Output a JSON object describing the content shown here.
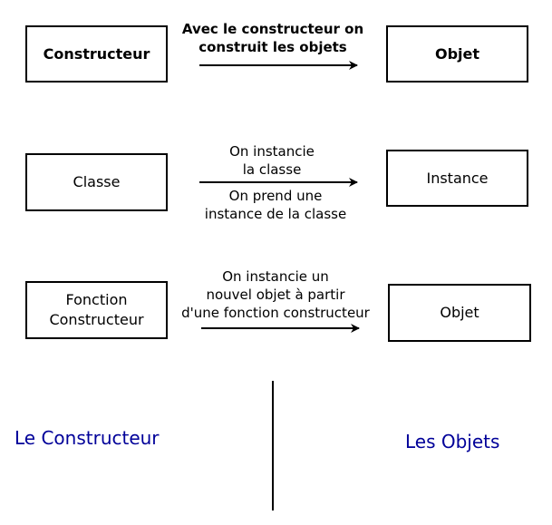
{
  "rows": [
    {
      "source": "Constructeur",
      "target": "Objet",
      "label_above": [
        "Avec le constructeur on",
        "construit les objets"
      ],
      "label_below": []
    },
    {
      "source": "Classe",
      "target": "Instance",
      "label_above": [
        "On instancie",
        "la classe"
      ],
      "label_below": [
        "On prend une",
        "instance de la classe"
      ]
    },
    {
      "source": [
        "Fonction",
        "Constructeur"
      ],
      "target": "Objet",
      "label_above": [
        "On instancie un",
        "nouvel objet à partir",
        "d'une fonction constructeur"
      ],
      "label_below": []
    }
  ],
  "footer": {
    "left": "Le Constructeur",
    "right": "Les Objets"
  },
  "colors": {
    "footer_text": "#000099",
    "stroke": "#000000"
  }
}
